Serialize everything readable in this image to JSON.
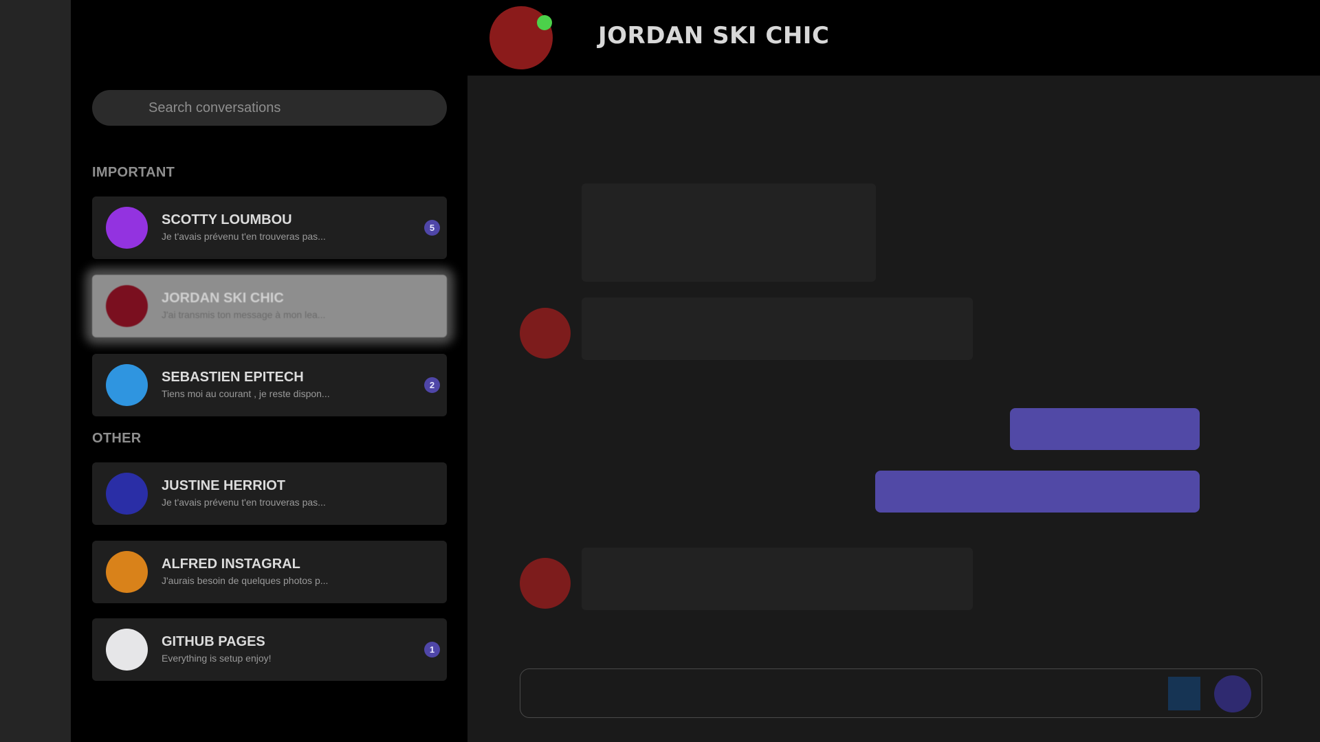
{
  "search": {
    "placeholder": "Search conversations"
  },
  "sections": {
    "important": "IMPORTANT",
    "other": "OTHER"
  },
  "conversations": {
    "important": [
      {
        "name": "SCOTTY LOUMBOU",
        "preview": "Je t'avais prévenu t'en trouveras pas...",
        "badge": "5",
        "avatar_color": "#9333e0"
      },
      {
        "name": "JORDAN SKI CHIC",
        "preview": "J'ai transmis ton message à mon lea...",
        "avatar_color": "#7a0f1f"
      },
      {
        "name": "SEBASTIEN EPITECH",
        "preview": "Tiens moi au courant , je reste dispon...",
        "badge": "2",
        "avatar_color": "#2f95e0"
      }
    ],
    "other": [
      {
        "name": "JUSTINE HERRIOT",
        "preview": "Je t'avais prévenu t'en trouveras pas...",
        "avatar_color": "#2a2ea6"
      },
      {
        "name": "ALFRED INSTAGRAL",
        "preview": "J'aurais besoin de quelques photos p...",
        "avatar_color": "#d9821a"
      },
      {
        "name": "GITHUB PAGES",
        "preview": "Everything is setup enjoy!",
        "badge": "1",
        "avatar_color": "#e6e6e8"
      }
    ]
  },
  "header": {
    "title": "JORDAN SKI CHIC",
    "online_color": "#4cd14a",
    "avatar_color": "#8b1b1b"
  },
  "colors": {
    "accent": "#5149a6",
    "bubble_in": "#222222",
    "background": "#1a1a1a"
  }
}
